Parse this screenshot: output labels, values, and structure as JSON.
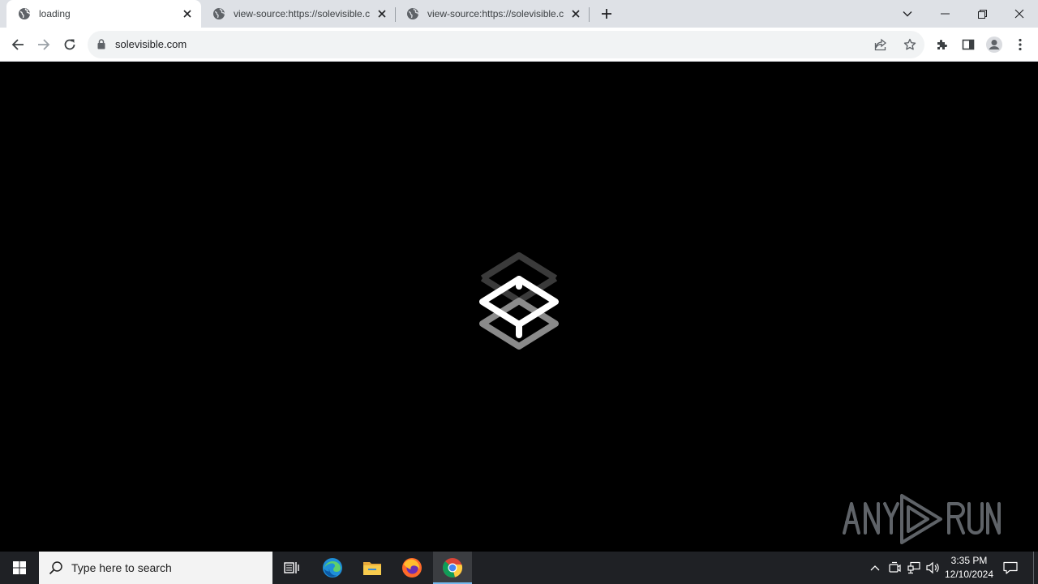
{
  "browser": {
    "tabs": [
      {
        "title": "loading",
        "icon": "globe-icon",
        "active": true
      },
      {
        "title": "view-source:https://solevisible.c",
        "icon": "globe-icon",
        "active": false
      },
      {
        "title": "view-source:https://solevisible.c",
        "icon": "globe-icon",
        "active": false
      }
    ],
    "address": {
      "url": "solevisible.com"
    }
  },
  "taskbar": {
    "search_placeholder": "Type here to search",
    "clock": {
      "time": "3:35 PM",
      "date": "12/10/2024"
    },
    "apps": [
      "task-view-icon",
      "edge-icon",
      "file-explorer-icon",
      "firefox-icon",
      "chrome-icon"
    ]
  },
  "colors": {
    "tabstrip": "#dee1e6",
    "toolbar": "#ffffff",
    "omnibox": "#f1f3f4",
    "page_background": "#000000",
    "taskbar": "#1f2125"
  }
}
